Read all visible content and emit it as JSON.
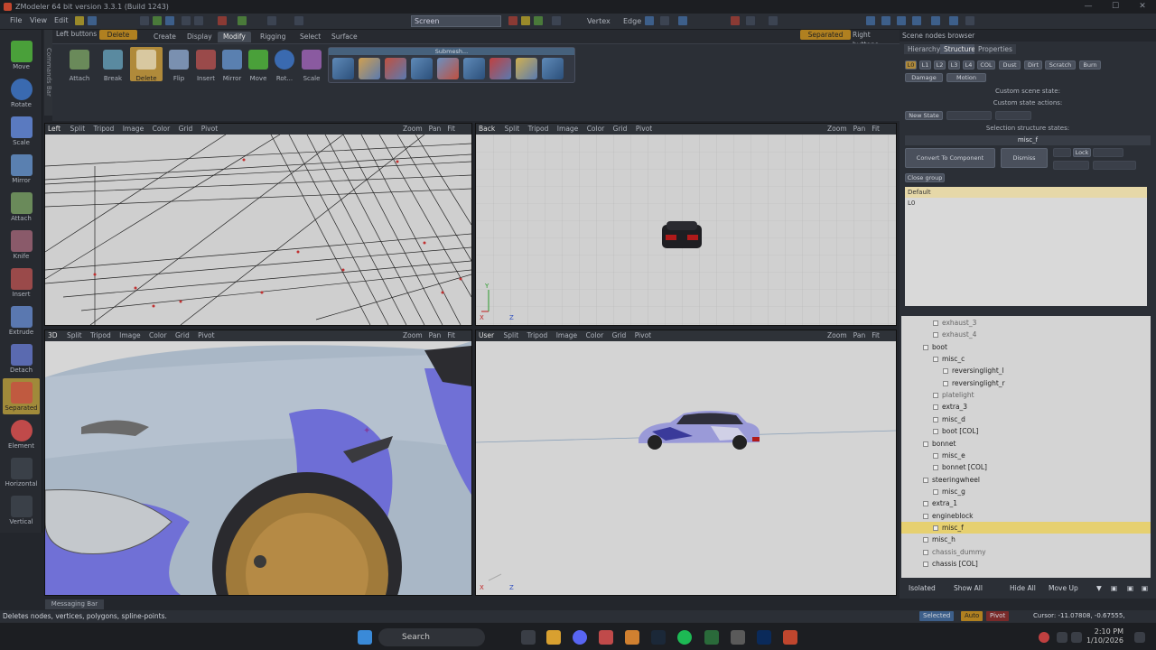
{
  "window": {
    "title": "ZModeler 64 bit version 3.3.1 (Build 1243)"
  },
  "menu": {
    "file": "File",
    "view": "View",
    "edit": "Edit"
  },
  "toolbar": {
    "screen_dropdown": "Screen",
    "vertex": "Vertex",
    "edge": "Edge"
  },
  "toolbox": {
    "items": [
      "Move",
      "Rotate",
      "Scale",
      "Mirror",
      "Attach",
      "Knife",
      "Insert",
      "Extrude",
      "Detach",
      "Separated",
      "Element",
      "Horizontal",
      "Vertical"
    ]
  },
  "commands_bar": "Commands Bar",
  "ribbon": {
    "left_buttons": "Left buttons",
    "delete_toggle": "Delete",
    "tabs": [
      "Create",
      "Display",
      "Modify",
      "Rigging",
      "Select",
      "Surface"
    ],
    "separated_toggle": "Separated",
    "right_buttons": "Right buttons",
    "buttons": [
      "Attach",
      "Break",
      "Delete",
      "Flip",
      "Insert",
      "Mirror",
      "Move",
      "Rot...",
      "Scale"
    ],
    "submesh_title": "Submesh..."
  },
  "viewports": {
    "left": {
      "name": "Left"
    },
    "back": {
      "name": "Back"
    },
    "persp": {
      "name": "3D"
    },
    "user": {
      "name": "User"
    },
    "menu": [
      "Split",
      "Tripod",
      "Image",
      "Color",
      "Grid",
      "Pivot"
    ],
    "right_menu": [
      "Zoom",
      "Pan",
      "Fit"
    ]
  },
  "scene_browser": {
    "title": "Scene nodes browser",
    "tabs": [
      "Hierarchy",
      "Structure",
      "Properties"
    ],
    "lod_chips": [
      "L0",
      "L1",
      "L2",
      "L3",
      "L4",
      "COL",
      "Dust",
      "Dirt",
      "Scratch",
      "Burn"
    ],
    "damage": "Damage",
    "motion": "Motion",
    "custom_scene_state": "Custom scene state:",
    "custom_state_actions": "Custom state actions:",
    "new_state": "New State",
    "selection_structure_states": "Selection structure states:",
    "selected_node": "misc_f",
    "convert": "Convert To Component",
    "dismiss": "Dismiss",
    "lock": "Lock",
    "close_group": "Close group",
    "states_header": "Default",
    "states_rows": [
      "L0"
    ],
    "tree": [
      {
        "label": "exhaust_3",
        "indent": 1
      },
      {
        "label": "exhaust_4",
        "indent": 1
      },
      {
        "label": "boot",
        "indent": 0
      },
      {
        "label": "misc_c",
        "indent": 1
      },
      {
        "label": "reversinglight_l",
        "indent": 2
      },
      {
        "label": "reversinglight_r",
        "indent": 2
      },
      {
        "label": "platelight",
        "indent": 1
      },
      {
        "label": "extra_3",
        "indent": 1
      },
      {
        "label": "misc_d",
        "indent": 1
      },
      {
        "label": "boot [COL]",
        "indent": 1
      },
      {
        "label": "bonnet",
        "indent": 0
      },
      {
        "label": "misc_e",
        "indent": 1
      },
      {
        "label": "bonnet [COL]",
        "indent": 1
      },
      {
        "label": "steeringwheel",
        "indent": 0
      },
      {
        "label": "misc_g",
        "indent": 1
      },
      {
        "label": "extra_1",
        "indent": 0
      },
      {
        "label": "engineblock",
        "indent": 0
      },
      {
        "label": "misc_f",
        "indent": 1,
        "selected": true
      },
      {
        "label": "misc_h",
        "indent": 0
      },
      {
        "label": "chassis_dummy",
        "indent": 0
      },
      {
        "label": "chassis [COL]",
        "indent": 0
      }
    ],
    "bottom_buttons": [
      "Isolated",
      "Show All",
      "Hide All",
      "Move Up"
    ]
  },
  "messaging_bar": "Messaging Bar",
  "status": {
    "text": "Deletes nodes, vertices, polygons, spline-points.",
    "selected": "Selected",
    "auto": "Auto",
    "pivot": "Pivot",
    "cursor": "Cursor: -11.07808, -0.67555, 0.00000"
  },
  "taskbar": {
    "search": "Search",
    "time": "2:10 PM",
    "date": "1/10/2026"
  },
  "colors": {
    "accent": "#b08a3a",
    "selection": "#e6d070"
  }
}
